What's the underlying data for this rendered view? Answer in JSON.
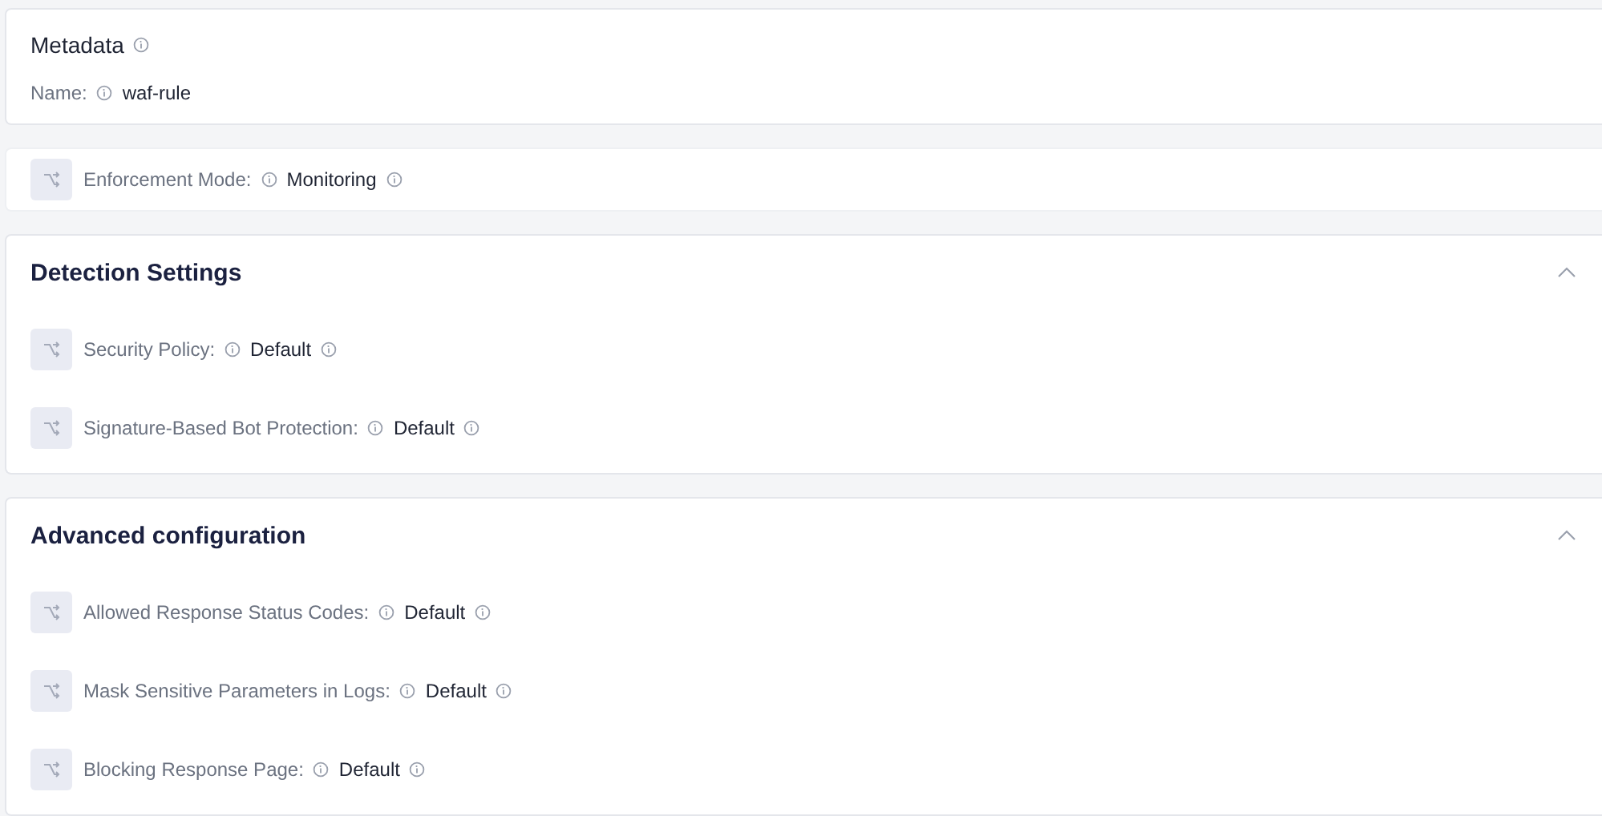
{
  "metadata": {
    "title": "Metadata",
    "fields": [
      {
        "label": "Name:",
        "value": "waf-rule"
      }
    ]
  },
  "enforcement": {
    "label": "Enforcement Mode:",
    "value": "Monitoring"
  },
  "sections": [
    {
      "title": "Detection Settings",
      "expanded": true,
      "rows": [
        {
          "label": "Security Policy:",
          "value": "Default"
        },
        {
          "label": "Signature-Based Bot Protection:",
          "value": "Default"
        }
      ]
    },
    {
      "title": "Advanced configuration",
      "expanded": true,
      "rows": [
        {
          "label": "Allowed Response Status Codes:",
          "value": "Default"
        },
        {
          "label": "Mask Sensitive Parameters in Logs:",
          "value": "Default"
        },
        {
          "label": "Blocking Response Page:",
          "value": "Default"
        }
      ]
    }
  ]
}
